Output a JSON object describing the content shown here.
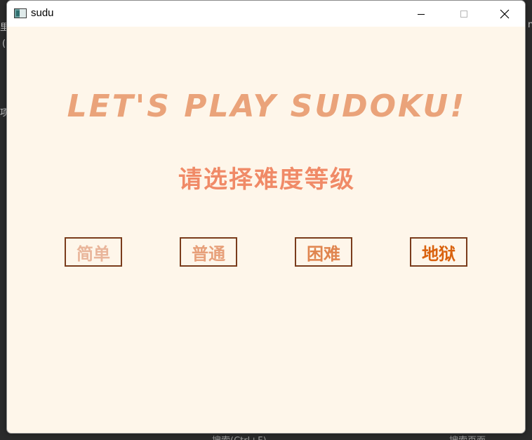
{
  "window": {
    "title": "sudu",
    "icon": "app-window-icon",
    "controls": [
      "minimize-icon",
      "maximize-icon",
      "close-icon"
    ]
  },
  "main": {
    "heading": "LET'S PLAY SUDOKU!",
    "subtitle": "请选择难度等级",
    "levels": [
      {
        "label": "简单",
        "color": "#e9b59a"
      },
      {
        "label": "普通",
        "color": "#e7a07a"
      },
      {
        "label": "困难",
        "color": "#e0854f"
      },
      {
        "label": "地狱",
        "color": "#d9620e"
      }
    ]
  },
  "background": {
    "bottom_left_text": "搜索(Ctrl+F)",
    "bottom_right_text": "搜索页面"
  },
  "colors": {
    "window_bg": "#fef6ea",
    "heading": "#eaa37a",
    "subtitle": "#f08a67",
    "button_border": "#7a3c1c"
  }
}
